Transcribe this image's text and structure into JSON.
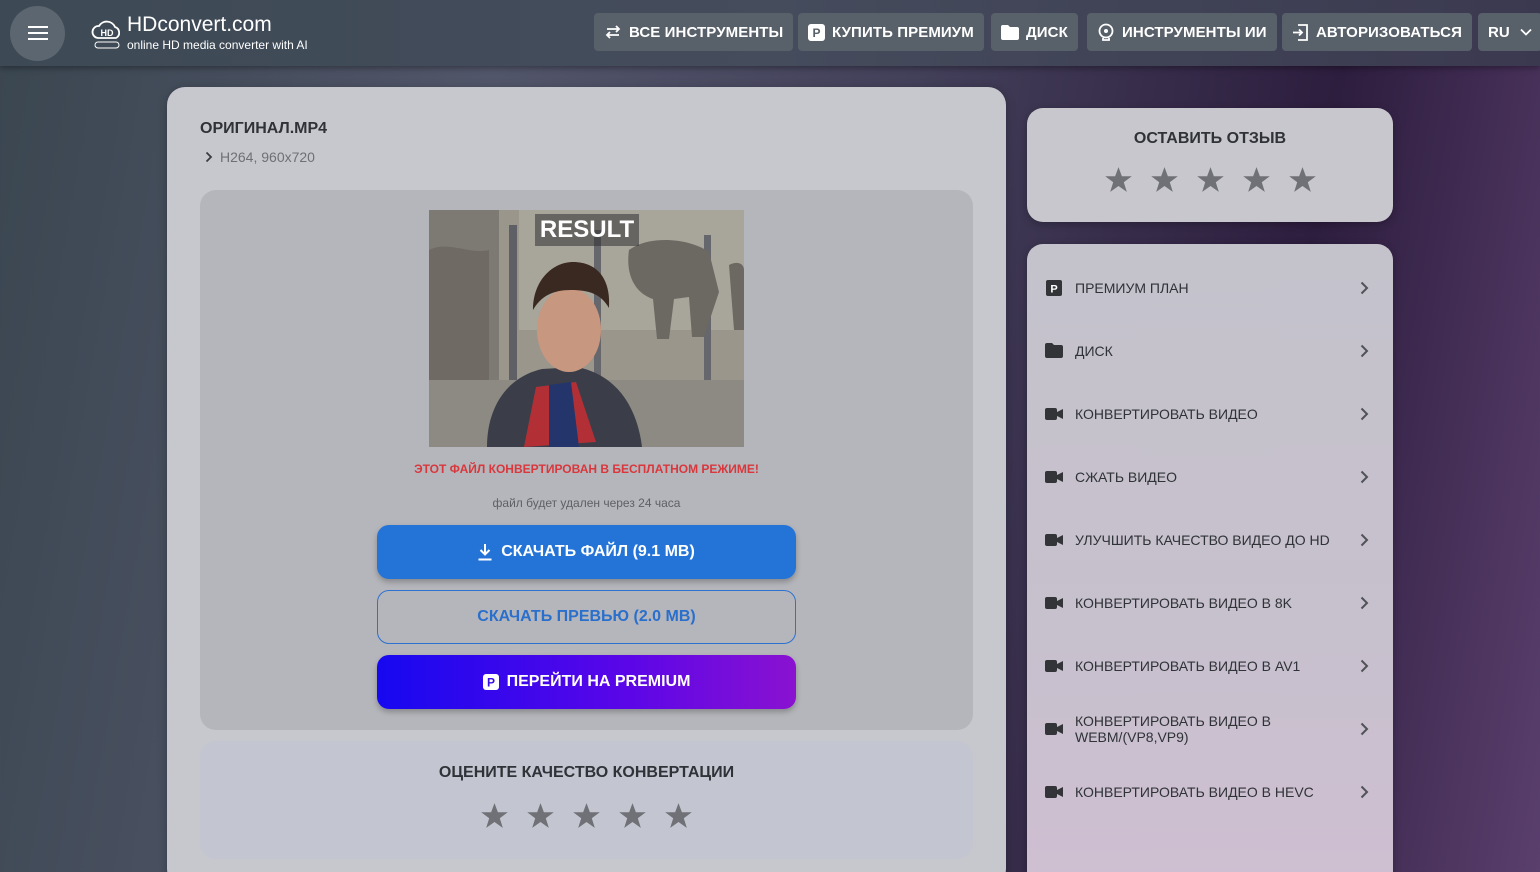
{
  "header": {
    "brand": "HDconvert.com",
    "tagline": "online HD media converter with AI",
    "nav": [
      {
        "label": "ВСЕ ИНСТРУМЕНТЫ",
        "icon": "swap-arrows-icon"
      },
      {
        "label": "КУПИТЬ ПРЕМИУМ",
        "icon": "premium-p-icon"
      },
      {
        "label": "ДИСК",
        "icon": "folder-icon"
      },
      {
        "label": "ИНСТРУМЕНТЫ ИИ",
        "icon": "ai-brain-icon"
      },
      {
        "label": "АВТОРИЗОВАТЬСЯ",
        "icon": "login-icon"
      }
    ],
    "language": "RU"
  },
  "main": {
    "file_name": "ОРИГИНАЛ.MP4",
    "file_info": "H264, 960x720",
    "result_label": "RESULT",
    "warning": "ЭТОТ ФАЙЛ КОНВЕРТИРОВАН В БЕСПЛАТНОМ РЕЖИМЕ!",
    "note": "файл будет удален через 24 часа",
    "download_label": "СКАЧАТЬ ФАЙЛ (9.1 MB)",
    "preview_label": "СКАЧАТЬ ПРЕВЬЮ (2.0 MB)",
    "premium_label": "ПЕРЕЙТИ НА PREMIUM",
    "rate_title": "ОЦЕНИТЕ КАЧЕСТВО КОНВЕРТАЦИИ",
    "rating": 0
  },
  "review": {
    "title": "ОСТАВИТЬ ОТЗЫВ",
    "rating": 0
  },
  "sidebar": {
    "items": [
      {
        "label": "ПРЕМИУМ ПЛАН",
        "icon": "premium-p-icon"
      },
      {
        "label": "ДИСК",
        "icon": "folder-icon"
      },
      {
        "label": "КОНВЕРТИРОВАТЬ ВИДЕО",
        "icon": "video-camera-icon"
      },
      {
        "label": "СЖАТЬ ВИДЕО",
        "icon": "video-camera-icon"
      },
      {
        "label": "УЛУЧШИТЬ КАЧЕСТВО ВИДЕО ДО HD",
        "icon": "video-camera-icon"
      },
      {
        "label": "КОНВЕРТИРОВАТЬ ВИДЕО В 8K",
        "icon": "video-camera-icon"
      },
      {
        "label": "КОНВЕРТИРОВАТЬ ВИДЕО В AV1",
        "icon": "video-camera-icon"
      },
      {
        "label": "КОНВЕРТИРОВАТЬ ВИДЕО В WEBM/(VP8,VP9)",
        "icon": "video-camera-icon"
      },
      {
        "label": "КОНВЕРТИРОВАТЬ ВИДЕО В HEVC",
        "icon": "video-camera-icon"
      }
    ]
  },
  "colors": {
    "download_button": "#2474d8",
    "warning_text": "#d9373c",
    "premium_gradient_start": "#1608f0",
    "premium_gradient_end": "#8a12d0"
  }
}
